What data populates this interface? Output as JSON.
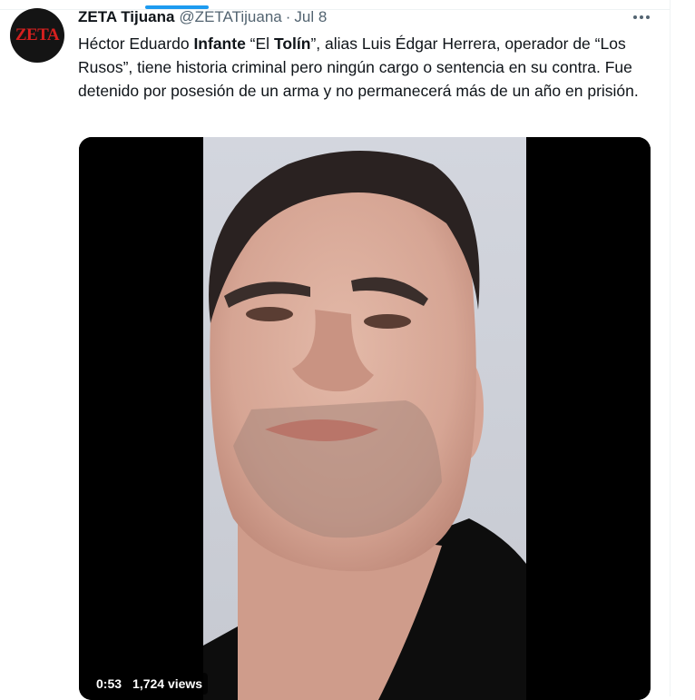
{
  "tweet": {
    "author": {
      "avatar_text": "ZETA",
      "display_name": "ZETA Tijuana",
      "handle": "@ZETATijuana",
      "separator": "·",
      "date": "Jul 8"
    },
    "text": {
      "p1": "Héctor Eduardo ",
      "h1": "Infante",
      "p2": " “El ",
      "h2": "Tolín",
      "p3": "”, alias Luis Édgar Herrera, operador de “Los Rusos”, tiene historia criminal pero ningún cargo o sentencia en su contra. Fue detenido por posesión de un arma y no permanecerá más de un año en prisión."
    },
    "media": {
      "duration": "0:53",
      "views": "1,724 views"
    }
  },
  "colors": {
    "accent": "#1d9bf0",
    "text": "#0f1419",
    "secondary": "#536471",
    "brand_red": "#d4201f"
  },
  "icons": {
    "more": "more-horizontal-icon"
  }
}
